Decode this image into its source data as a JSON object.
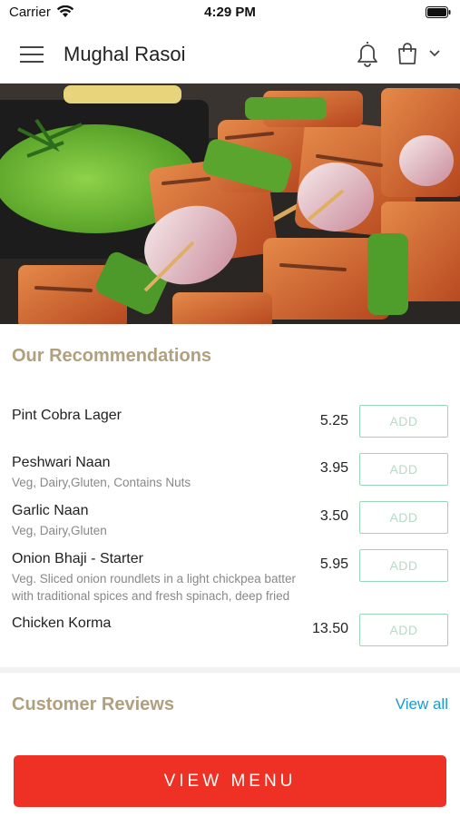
{
  "status_bar": {
    "carrier": "Carrier",
    "time": "4:29 PM"
  },
  "header": {
    "title": "Mughal Rasoi",
    "icons": [
      "menu-icon",
      "bell-icon",
      "cart-icon",
      "chevron-down-icon"
    ]
  },
  "hero": {
    "icon": "paneer-tikka-image"
  },
  "recommendations": {
    "title": "Our Recommendations",
    "add_label": "ADD",
    "items": [
      {
        "name": "Pint Cobra Lager",
        "description": "",
        "price": "5.25"
      },
      {
        "name": "Peshwari Naan",
        "description": "Veg, Dairy,Gluten, Contains Nuts",
        "price": "3.95"
      },
      {
        "name": "Garlic Naan",
        "description": "Veg, Dairy,Gluten",
        "price": "3.50"
      },
      {
        "name": "Onion Bhaji - Starter",
        "description": "Veg. Sliced onion roundlets in a light chickpea batter with traditional spices and fresh spinach, deep fried",
        "price": "5.95"
      },
      {
        "name": "Chicken Korma",
        "description": "",
        "price": "13.50"
      }
    ]
  },
  "reviews": {
    "title": "Customer Reviews",
    "view_all": "View all"
  },
  "footer": {
    "view_menu": "VIEW MENU"
  },
  "colors": {
    "accent_title": "#b0a07e",
    "add_border": "#9ad7b4",
    "link": "#1a9ad6",
    "primary_button": "#ee3124"
  }
}
